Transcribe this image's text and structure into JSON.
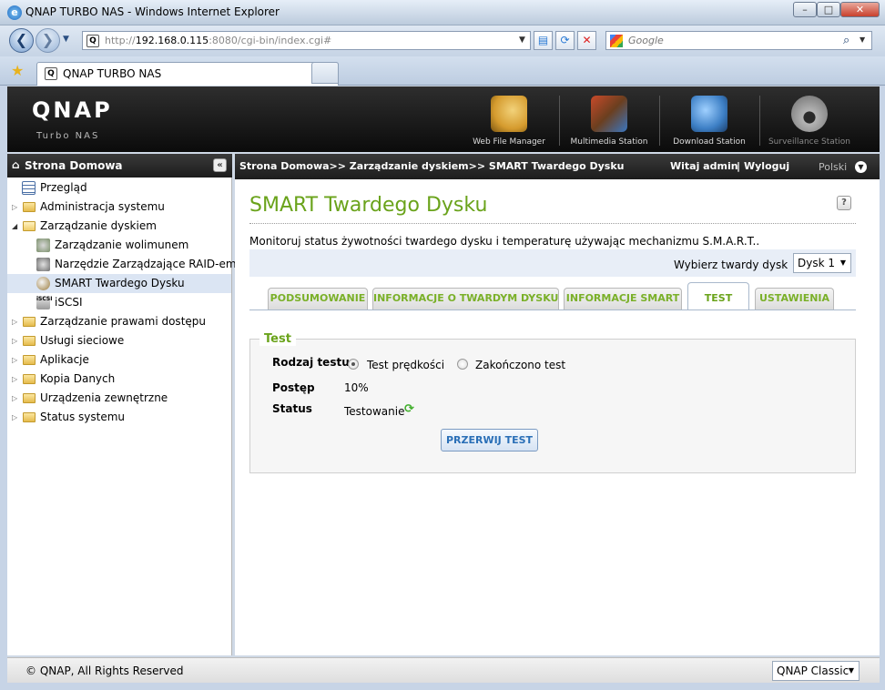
{
  "window": {
    "title": "QNAP TURBO NAS - Windows Internet Explorer",
    "minimize": "–",
    "maximize": "□",
    "close": "✕"
  },
  "browser": {
    "url_prefix": "http://",
    "url_host": "192.168.0.115",
    "url_rest": ":8080/cgi-bin/index.cgi#",
    "search_placeholder": "Google",
    "tab_title": "QNAP TURBO NAS"
  },
  "header": {
    "logo": "QNAP",
    "logo_sub": "Turbo NAS",
    "apps": [
      {
        "label": "Web File Manager",
        "icon": "file-manager-icon",
        "color": "#d59b2e"
      },
      {
        "label": "Multimedia Station",
        "icon": "multimedia-icon",
        "color": "#6b3f1f"
      },
      {
        "label": "Download Station",
        "icon": "download-icon",
        "color": "#3d7fc5"
      },
      {
        "label": "Surveillance Station",
        "icon": "camera-icon",
        "color": "#8a8a8a"
      }
    ]
  },
  "sidebar": {
    "title": "Strona Domowa",
    "items": [
      {
        "label": "Przegląd",
        "icon": "overview-icon",
        "level": 0,
        "arrow": ""
      },
      {
        "label": "Administracja systemu",
        "icon": "folder-icon",
        "level": 0,
        "arrow": "▷"
      },
      {
        "label": "Zarządzanie dyskiem",
        "icon": "folder-icon",
        "level": 0,
        "arrow": "◢"
      },
      {
        "label": "Zarządzanie wolimunem",
        "icon": "volume-icon",
        "level": 1,
        "arrow": ""
      },
      {
        "label": "Narzędzie Zarządzające RAID-em",
        "icon": "raid-icon",
        "level": 1,
        "arrow": ""
      },
      {
        "label": "SMART Twardego Dysku",
        "icon": "smart-icon",
        "level": 1,
        "arrow": "",
        "selected": true
      },
      {
        "label": "iSCSI",
        "icon": "iscsi-icon",
        "level": 1,
        "arrow": ""
      },
      {
        "label": "Zarządzanie prawami dostępu",
        "icon": "folder-icon",
        "level": 0,
        "arrow": "▷"
      },
      {
        "label": "Usługi sieciowe",
        "icon": "folder-icon",
        "level": 0,
        "arrow": "▷"
      },
      {
        "label": "Aplikacje",
        "icon": "folder-icon",
        "level": 0,
        "arrow": "▷"
      },
      {
        "label": "Kopia Danych",
        "icon": "folder-icon",
        "level": 0,
        "arrow": "▷"
      },
      {
        "label": "Urządzenia zewnętrzne",
        "icon": "folder-icon",
        "level": 0,
        "arrow": "▷"
      },
      {
        "label": "Status systemu",
        "icon": "folder-icon",
        "level": 0,
        "arrow": "▷"
      }
    ]
  },
  "topbar": {
    "breadcrumb": "Strona Domowa>> Zarządzanie dyskiem>> SMART Twardego Dysku",
    "welcome": "Witaj admin",
    "separator": "|",
    "logout": "Wyloguj",
    "language": "Polski"
  },
  "main": {
    "title": "SMART Twardego Dysku",
    "help": "?",
    "description": "Monitoruj status żywotności twardego dysku i temperaturę używając mechanizmu S.M.A.R.T..",
    "disk_label": "Wybierz twardy dysk",
    "disk_value": "Dysk 1",
    "tabs": [
      "PODSUMOWANIE",
      "INFORMACJE O TWARDYM DYSKU",
      "INFORMACJE SMART",
      "TEST",
      "USTAWIENIA"
    ],
    "active_tab": "TEST",
    "test": {
      "legend": "Test",
      "type_label": "Rodzaj testu",
      "option_fast": "Test prędkości",
      "option_complete": "Zakończono test",
      "selected_option": "Test prędkości",
      "progress_label": "Postęp",
      "progress_value": "10%",
      "status_label": "Status",
      "status_value": "Testowanie",
      "stop_button": "PRZERWIJ TEST"
    }
  },
  "footer": {
    "copyright": "© QNAP, All Rights Reserved",
    "theme": "QNAP Classic"
  },
  "colors": {
    "accent_green": "#6aa31b",
    "header_dark": "#1c1c1c",
    "selection": "#dbe5f3",
    "link_blue": "#2a6fb7"
  }
}
